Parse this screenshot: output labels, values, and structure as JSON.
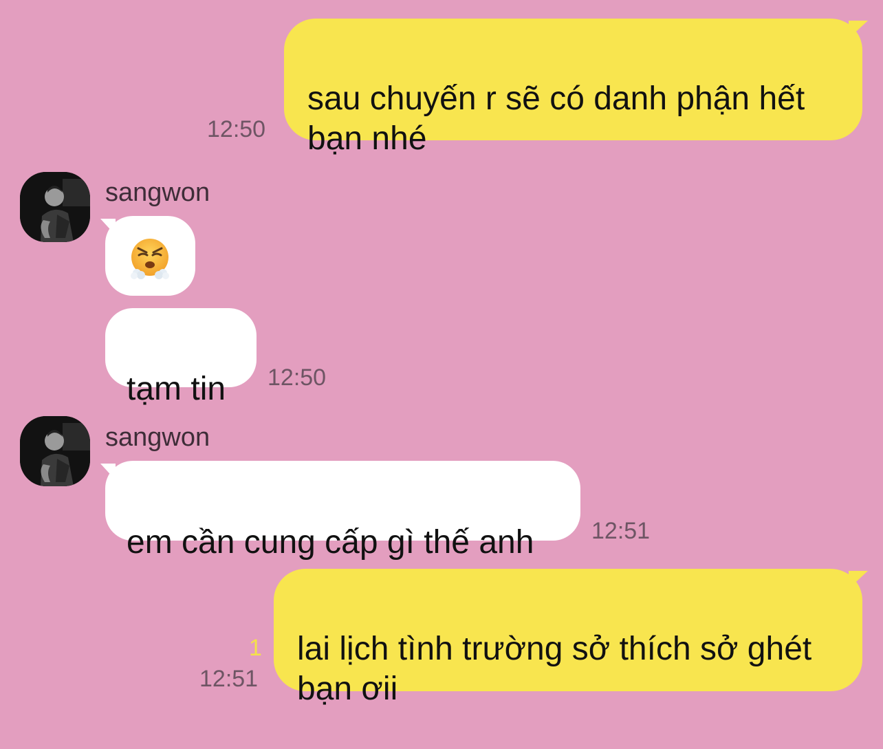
{
  "conversation": {
    "messages": [
      {
        "direction": "outgoing",
        "text": "sau chuyến r sẽ có danh phận hết\nbạn nhé",
        "time": "12:50"
      },
      {
        "direction": "incoming",
        "sender": "sangwon",
        "text": "",
        "emoji_icon": "face-with-steam-from-nose-icon"
      },
      {
        "direction": "incoming",
        "text": "tạm tin",
        "time": "12:50"
      },
      {
        "direction": "incoming",
        "sender": "sangwon",
        "text": "em cần cung cấp gì thế anh",
        "time": "12:51"
      },
      {
        "direction": "outgoing",
        "text": "lai lịch tình trường sở thích sở ghét\nbạn ơii",
        "time": "12:51",
        "unread_count": "1"
      }
    ]
  },
  "colors": {
    "background": "#e39ebf",
    "outgoing_bubble": "#f8e54f",
    "incoming_bubble": "#ffffff",
    "timestamp": "#6e5564",
    "unread_count": "#f4e14a"
  }
}
